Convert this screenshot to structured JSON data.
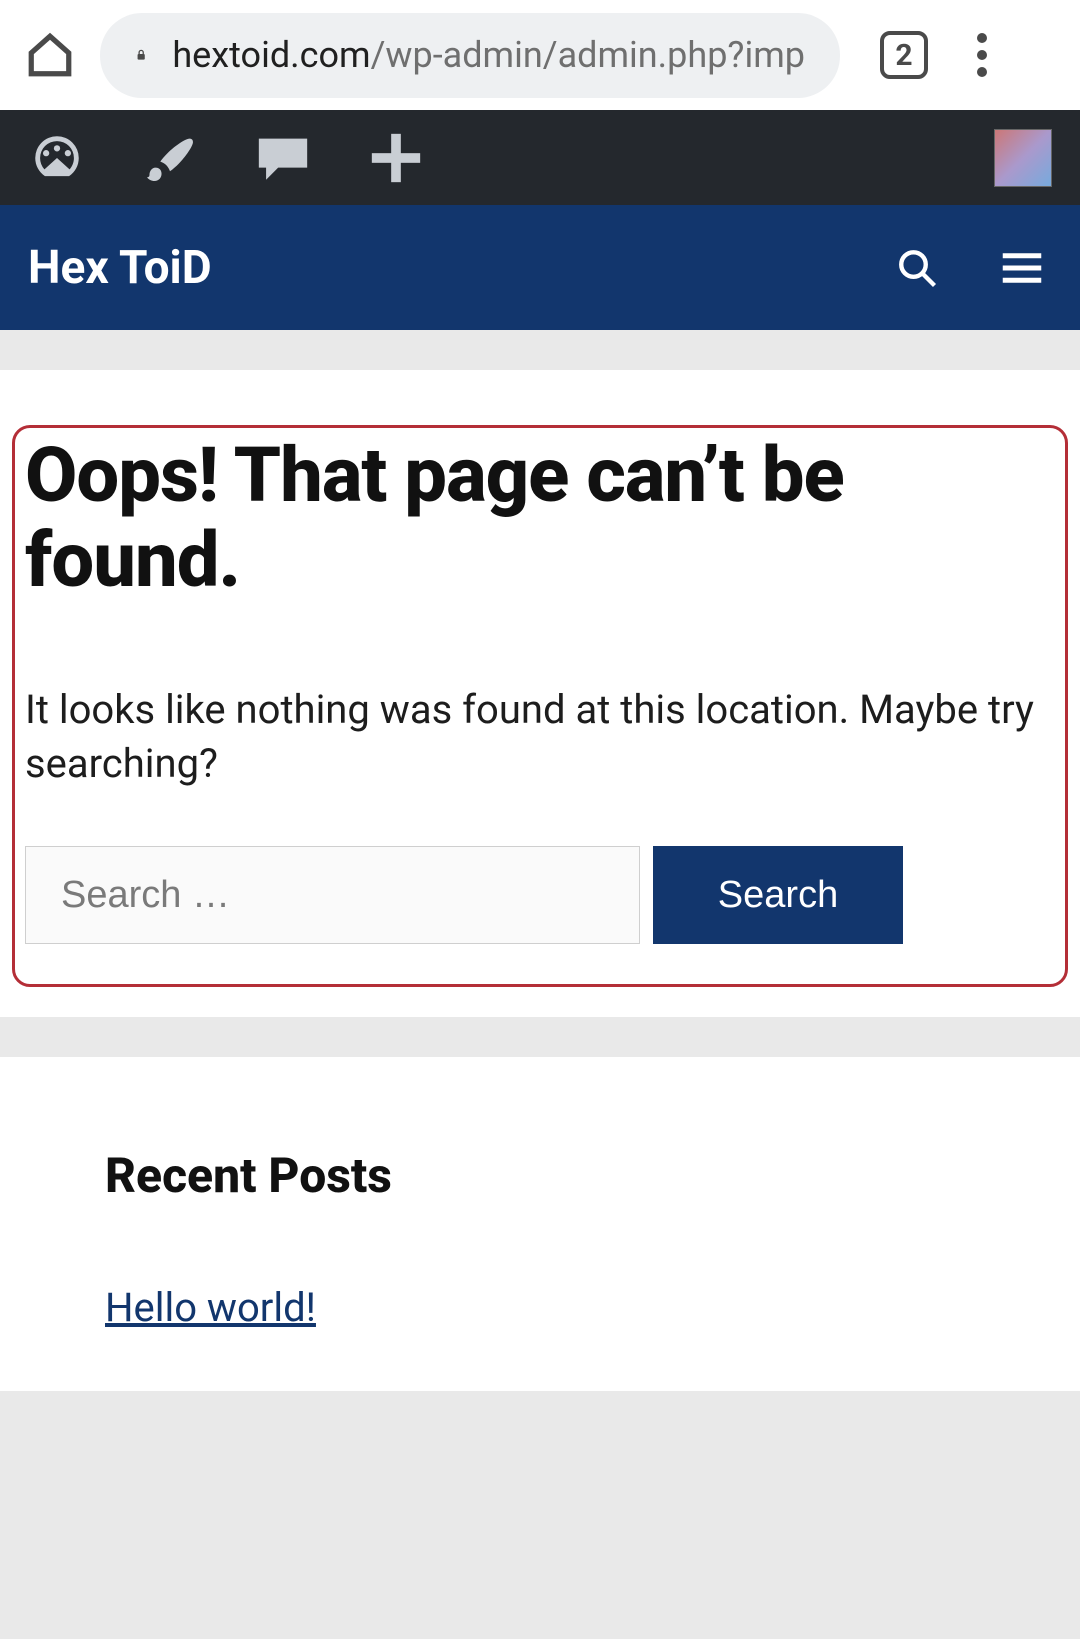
{
  "browser": {
    "url_host": "hextoid.com",
    "url_path": "/wp-admin/admin.php?imp",
    "tab_count": "2"
  },
  "site": {
    "title": "Hex ToiD"
  },
  "error_page": {
    "heading": "Oops! That page can’t be found.",
    "message": "It looks like nothing was found at this location. Maybe try searching?",
    "search_placeholder": "Search …",
    "search_button": "Search"
  },
  "recent": {
    "heading": "Recent Posts",
    "posts": [
      "Hello world!"
    ]
  },
  "icons": {
    "home": "home-icon",
    "lock": "lock-icon",
    "overflow": "overflow-icon",
    "dashboard": "dashboard-icon",
    "brush": "brush-icon",
    "comment": "comment-icon",
    "plus": "plus-icon",
    "avatar": "avatar",
    "search": "search-icon",
    "menu": "hamburger-icon"
  }
}
